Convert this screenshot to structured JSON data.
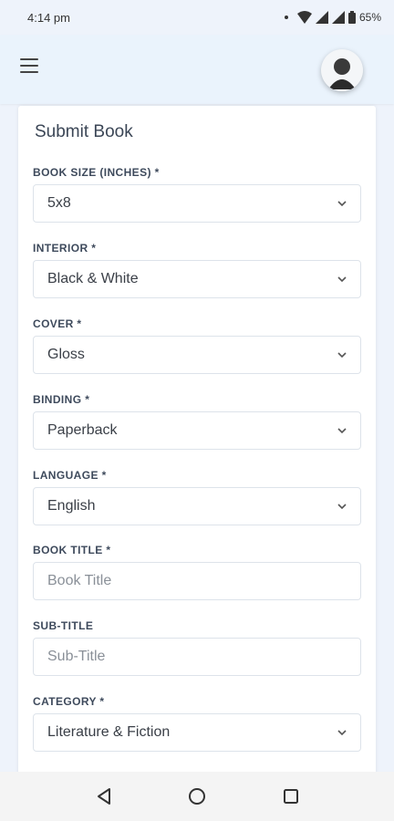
{
  "status_bar": {
    "time": "4:14 pm",
    "battery": "65%"
  },
  "header": {
    "menu_icon": "menu-icon",
    "avatar_icon": "user-avatar-icon"
  },
  "form": {
    "title": "Submit Book",
    "fields": [
      {
        "label": "BOOK SIZE (INCHES) *",
        "value": "5x8",
        "type": "select"
      },
      {
        "label": "INTERIOR *",
        "value": "Black & White",
        "type": "select"
      },
      {
        "label": "COVER *",
        "value": "Gloss",
        "type": "select"
      },
      {
        "label": "BINDING *",
        "value": "Paperback",
        "type": "select"
      },
      {
        "label": "LANGUAGE *",
        "value": "English",
        "type": "select"
      },
      {
        "label": "BOOK TITLE *",
        "placeholder": "Book Title",
        "type": "input"
      },
      {
        "label": "SUB-TITLE",
        "placeholder": "Sub-Title",
        "type": "input"
      },
      {
        "label": "CATEGORY *",
        "value": "Literature & Fiction",
        "type": "select"
      }
    ]
  },
  "nav": {
    "back_icon": "back-triangle-icon",
    "home_icon": "home-circle-icon",
    "recents_icon": "recents-square-icon"
  }
}
